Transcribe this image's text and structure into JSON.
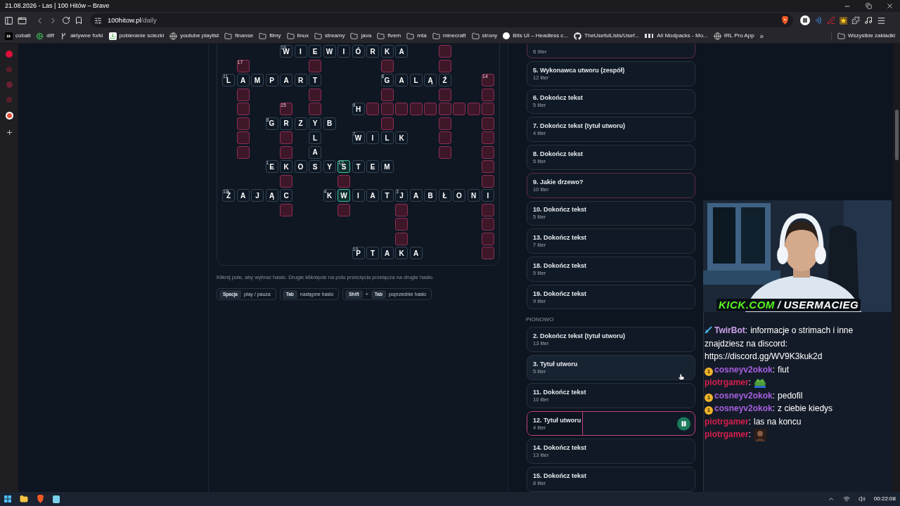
{
  "window": {
    "title": "21.08.2026 - Las | 100 Hitów – Brave"
  },
  "address_bar": {
    "host": "100hitow.pl",
    "path": "/daily"
  },
  "bookmarks": [
    {
      "kind": "link",
      "label": "cobalt"
    },
    {
      "kind": "link",
      "label": "diff"
    },
    {
      "kind": "link",
      "label": "aktywne forki"
    },
    {
      "kind": "link",
      "label": "pobieranie sciezki"
    },
    {
      "kind": "link",
      "label": "youtube playlist"
    },
    {
      "kind": "folder",
      "label": "finanse"
    },
    {
      "kind": "folder",
      "label": "filmy"
    },
    {
      "kind": "folder",
      "label": "linux"
    },
    {
      "kind": "folder",
      "label": "streamy"
    },
    {
      "kind": "folder",
      "label": "java"
    },
    {
      "kind": "folder",
      "label": "fivem"
    },
    {
      "kind": "folder",
      "label": "mta"
    },
    {
      "kind": "folder",
      "label": "minecraft"
    },
    {
      "kind": "folder",
      "label": "strony"
    },
    {
      "kind": "link",
      "label": "Bits UI – Headless c..."
    },
    {
      "kind": "link",
      "label": "TheUsefulLists/Usef..."
    },
    {
      "kind": "link",
      "label": "All Modpacks - Mo..."
    },
    {
      "kind": "link",
      "label": "IRL Pro App"
    }
  ],
  "bookmarks_overflow": "»",
  "all_bookmarks": "Wszystkie zakładki",
  "crossword": {
    "rows": [
      {
        "cells": [
          {
            "kind": "blank"
          },
          {
            "kind": "blank"
          },
          {
            "kind": "blank"
          },
          {
            "kind": "blank"
          },
          {
            "kind": "letter",
            "letter": "W",
            "number": "19",
            "selected": false
          },
          {
            "kind": "letter",
            "letter": "I",
            "selected": false
          },
          {
            "kind": "letter",
            "letter": "E",
            "selected": false
          },
          {
            "kind": "letter",
            "letter": "W",
            "selected": false
          },
          {
            "kind": "letter",
            "letter": "I",
            "selected": false
          },
          {
            "kind": "letter",
            "letter": "Ó",
            "selected": false
          },
          {
            "kind": "letter",
            "letter": "R",
            "selected": false
          },
          {
            "kind": "letter",
            "letter": "K",
            "selected": false
          },
          {
            "kind": "letter",
            "letter": "A",
            "selected": false
          },
          {
            "kind": "blank"
          },
          {
            "kind": "blank"
          },
          {
            "kind": "empty",
            "selected": false
          },
          {
            "kind": "blank"
          },
          {
            "kind": "blank"
          },
          {
            "kind": "blank"
          }
        ]
      },
      {
        "cells": [
          {
            "kind": "blank"
          },
          {
            "kind": "empty",
            "number": "17",
            "selected": false
          },
          {
            "kind": "blank"
          },
          {
            "kind": "blank"
          },
          {
            "kind": "blank"
          },
          {
            "kind": "blank"
          },
          {
            "kind": "empty",
            "selected": false
          },
          {
            "kind": "blank"
          },
          {
            "kind": "blank"
          },
          {
            "kind": "blank"
          },
          {
            "kind": "blank"
          },
          {
            "kind": "empty",
            "selected": false
          },
          {
            "kind": "blank"
          },
          {
            "kind": "blank"
          },
          {
            "kind": "blank"
          },
          {
            "kind": "empty",
            "selected": false
          },
          {
            "kind": "blank"
          },
          {
            "kind": "blank"
          },
          {
            "kind": "blank"
          }
        ]
      },
      {
        "cells": [
          {
            "kind": "letter",
            "letter": "L",
            "number": "11",
            "selected": false
          },
          {
            "kind": "letter",
            "letter": "A",
            "selected": false
          },
          {
            "kind": "letter",
            "letter": "M",
            "selected": false
          },
          {
            "kind": "letter",
            "letter": "P",
            "selected": false
          },
          {
            "kind": "letter",
            "letter": "A",
            "selected": false
          },
          {
            "kind": "letter",
            "letter": "R",
            "selected": false
          },
          {
            "kind": "letter",
            "letter": "T",
            "selected": false
          },
          {
            "kind": "blank"
          },
          {
            "kind": "blank"
          },
          {
            "kind": "blank"
          },
          {
            "kind": "blank"
          },
          {
            "kind": "letter",
            "letter": "G",
            "number": "6",
            "selected": false
          },
          {
            "kind": "letter",
            "letter": "A",
            "selected": false
          },
          {
            "kind": "letter",
            "letter": "L",
            "selected": false
          },
          {
            "kind": "letter",
            "letter": "Ą",
            "selected": false
          },
          {
            "kind": "letter",
            "letter": "Ź",
            "selected": false
          },
          {
            "kind": "blank"
          },
          {
            "kind": "blank"
          },
          {
            "kind": "empty",
            "number": "14",
            "selected": false
          }
        ]
      },
      {
        "cells": [
          {
            "kind": "blank"
          },
          {
            "kind": "empty",
            "selected": false
          },
          {
            "kind": "blank"
          },
          {
            "kind": "blank"
          },
          {
            "kind": "blank"
          },
          {
            "kind": "blank"
          },
          {
            "kind": "empty",
            "selected": false
          },
          {
            "kind": "blank"
          },
          {
            "kind": "blank"
          },
          {
            "kind": "blank"
          },
          {
            "kind": "blank"
          },
          {
            "kind": "empty",
            "selected": false
          },
          {
            "kind": "blank"
          },
          {
            "kind": "blank"
          },
          {
            "kind": "blank"
          },
          {
            "kind": "empty",
            "selected": false
          },
          {
            "kind": "blank"
          },
          {
            "kind": "blank"
          },
          {
            "kind": "empty",
            "selected": false
          }
        ]
      },
      {
        "cells": [
          {
            "kind": "blank"
          },
          {
            "kind": "empty",
            "selected": false
          },
          {
            "kind": "blank"
          },
          {
            "kind": "blank"
          },
          {
            "kind": "empty",
            "number": "15",
            "selected": false
          },
          {
            "kind": "blank"
          },
          {
            "kind": "empty",
            "selected": false
          },
          {
            "kind": "blank"
          },
          {
            "kind": "blank"
          },
          {
            "kind": "letter",
            "letter": "H",
            "number": "9",
            "selected": false
          },
          {
            "kind": "empty",
            "selected": false
          },
          {
            "kind": "empty",
            "selected": false
          },
          {
            "kind": "empty",
            "selected": false
          },
          {
            "kind": "empty",
            "selected": false
          },
          {
            "kind": "empty",
            "selected": false
          },
          {
            "kind": "empty",
            "selected": false
          },
          {
            "kind": "empty",
            "selected": false
          },
          {
            "kind": "empty",
            "selected": false
          },
          {
            "kind": "empty",
            "selected": false
          }
        ]
      },
      {
        "cells": [
          {
            "kind": "blank"
          },
          {
            "kind": "empty",
            "selected": false
          },
          {
            "kind": "blank"
          },
          {
            "kind": "letter",
            "letter": "G",
            "number": "8",
            "selected": false
          },
          {
            "kind": "letter",
            "letter": "R",
            "selected": false
          },
          {
            "kind": "letter",
            "letter": "Z",
            "selected": false
          },
          {
            "kind": "letter",
            "letter": "Y",
            "selected": false
          },
          {
            "kind": "letter",
            "letter": "B",
            "selected": false
          },
          {
            "kind": "blank"
          },
          {
            "kind": "blank"
          },
          {
            "kind": "blank"
          },
          {
            "kind": "empty",
            "selected": false
          },
          {
            "kind": "blank"
          },
          {
            "kind": "blank"
          },
          {
            "kind": "blank"
          },
          {
            "kind": "empty",
            "selected": false
          },
          {
            "kind": "blank"
          },
          {
            "kind": "blank"
          },
          {
            "kind": "empty",
            "selected": false
          }
        ]
      },
      {
        "cells": [
          {
            "kind": "blank"
          },
          {
            "kind": "empty",
            "selected": false
          },
          {
            "kind": "blank"
          },
          {
            "kind": "blank"
          },
          {
            "kind": "empty",
            "selected": false
          },
          {
            "kind": "blank"
          },
          {
            "kind": "letter",
            "letter": "L",
            "selected": false
          },
          {
            "kind": "blank"
          },
          {
            "kind": "blank"
          },
          {
            "kind": "letter",
            "letter": "W",
            "number": "7",
            "selected": false
          },
          {
            "kind": "letter",
            "letter": "I",
            "selected": false
          },
          {
            "kind": "letter",
            "letter": "L",
            "selected": false
          },
          {
            "kind": "letter",
            "letter": "K",
            "selected": false
          },
          {
            "kind": "blank"
          },
          {
            "kind": "blank"
          },
          {
            "kind": "empty",
            "selected": false
          },
          {
            "kind": "blank"
          },
          {
            "kind": "blank"
          },
          {
            "kind": "empty",
            "selected": false
          }
        ]
      },
      {
        "cells": [
          {
            "kind": "blank"
          },
          {
            "kind": "empty",
            "selected": false
          },
          {
            "kind": "blank"
          },
          {
            "kind": "blank"
          },
          {
            "kind": "empty",
            "selected": false
          },
          {
            "kind": "blank"
          },
          {
            "kind": "letter",
            "letter": "A",
            "selected": false
          },
          {
            "kind": "blank"
          },
          {
            "kind": "blank"
          },
          {
            "kind": "blank"
          },
          {
            "kind": "blank"
          },
          {
            "kind": "blank"
          },
          {
            "kind": "blank"
          },
          {
            "kind": "blank"
          },
          {
            "kind": "blank"
          },
          {
            "kind": "empty",
            "selected": false
          },
          {
            "kind": "blank"
          },
          {
            "kind": "blank"
          },
          {
            "kind": "empty",
            "selected": false
          }
        ]
      },
      {
        "cells": [
          {
            "kind": "blank"
          },
          {
            "kind": "blank"
          },
          {
            "kind": "blank"
          },
          {
            "kind": "letter",
            "letter": "E",
            "number": "1",
            "selected": false
          },
          {
            "kind": "letter",
            "letter": "K",
            "selected": false
          },
          {
            "kind": "letter",
            "letter": "O",
            "selected": false
          },
          {
            "kind": "letter",
            "letter": "S",
            "selected": false
          },
          {
            "kind": "letter",
            "letter": "Y",
            "selected": false
          },
          {
            "kind": "letter",
            "letter": "S",
            "number": "12",
            "selected": true
          },
          {
            "kind": "letter",
            "letter": "T",
            "selected": false
          },
          {
            "kind": "letter",
            "letter": "E",
            "selected": false
          },
          {
            "kind": "letter",
            "letter": "M",
            "selected": false
          },
          {
            "kind": "blank"
          },
          {
            "kind": "blank"
          },
          {
            "kind": "blank"
          },
          {
            "kind": "blank"
          },
          {
            "kind": "blank"
          },
          {
            "kind": "blank"
          },
          {
            "kind": "empty",
            "selected": false
          }
        ]
      },
      {
        "cells": [
          {
            "kind": "blank"
          },
          {
            "kind": "blank"
          },
          {
            "kind": "blank"
          },
          {
            "kind": "blank"
          },
          {
            "kind": "empty",
            "selected": false
          },
          {
            "kind": "blank"
          },
          {
            "kind": "blank"
          },
          {
            "kind": "blank"
          },
          {
            "kind": "empty",
            "selected": false
          },
          {
            "kind": "blank"
          },
          {
            "kind": "blank"
          },
          {
            "kind": "blank"
          },
          {
            "kind": "blank"
          },
          {
            "kind": "blank"
          },
          {
            "kind": "blank"
          },
          {
            "kind": "blank"
          },
          {
            "kind": "blank"
          },
          {
            "kind": "blank"
          },
          {
            "kind": "empty",
            "selected": false
          }
        ]
      },
      {
        "cells": [
          {
            "kind": "letter",
            "letter": "Ż",
            "number": "18",
            "selected": false
          },
          {
            "kind": "letter",
            "letter": "A",
            "selected": false
          },
          {
            "kind": "letter",
            "letter": "J",
            "selected": false
          },
          {
            "kind": "letter",
            "letter": "Ą",
            "selected": false
          },
          {
            "kind": "letter",
            "letter": "C",
            "selected": false
          },
          {
            "kind": "blank"
          },
          {
            "kind": "blank"
          },
          {
            "kind": "letter",
            "letter": "K",
            "number": "4",
            "selected": false
          },
          {
            "kind": "letter",
            "letter": "W",
            "selected": true
          },
          {
            "kind": "letter",
            "letter": "I",
            "selected": false
          },
          {
            "kind": "letter",
            "letter": "A",
            "selected": false
          },
          {
            "kind": "letter",
            "letter": "T",
            "selected": false
          },
          {
            "kind": "letter",
            "letter": "J",
            "number": "3",
            "selected": false
          },
          {
            "kind": "letter",
            "letter": "A",
            "selected": false
          },
          {
            "kind": "letter",
            "letter": "B",
            "selected": false
          },
          {
            "kind": "letter",
            "letter": "Ł",
            "selected": false
          },
          {
            "kind": "letter",
            "letter": "O",
            "selected": false
          },
          {
            "kind": "letter",
            "letter": "N",
            "selected": false
          },
          {
            "kind": "letter",
            "letter": "I",
            "selected": false
          }
        ]
      },
      {
        "cells": [
          {
            "kind": "blank"
          },
          {
            "kind": "blank"
          },
          {
            "kind": "blank"
          },
          {
            "kind": "blank"
          },
          {
            "kind": "empty",
            "selected": false
          },
          {
            "kind": "blank"
          },
          {
            "kind": "blank"
          },
          {
            "kind": "blank"
          },
          {
            "kind": "empty",
            "selected": false
          },
          {
            "kind": "blank"
          },
          {
            "kind": "blank"
          },
          {
            "kind": "blank"
          },
          {
            "kind": "empty",
            "selected": false
          },
          {
            "kind": "blank"
          },
          {
            "kind": "blank"
          },
          {
            "kind": "blank"
          },
          {
            "kind": "blank"
          },
          {
            "kind": "blank"
          },
          {
            "kind": "empty",
            "selected": false
          }
        ]
      },
      {
        "cells": [
          {
            "kind": "blank"
          },
          {
            "kind": "blank"
          },
          {
            "kind": "blank"
          },
          {
            "kind": "blank"
          },
          {
            "kind": "blank"
          },
          {
            "kind": "blank"
          },
          {
            "kind": "blank"
          },
          {
            "kind": "blank"
          },
          {
            "kind": "blank"
          },
          {
            "kind": "blank"
          },
          {
            "kind": "blank"
          },
          {
            "kind": "blank"
          },
          {
            "kind": "empty",
            "selected": false
          },
          {
            "kind": "blank"
          },
          {
            "kind": "blank"
          },
          {
            "kind": "blank"
          },
          {
            "kind": "blank"
          },
          {
            "kind": "blank"
          },
          {
            "kind": "empty",
            "selected": false
          }
        ]
      },
      {
        "cells": [
          {
            "kind": "blank"
          },
          {
            "kind": "blank"
          },
          {
            "kind": "blank"
          },
          {
            "kind": "blank"
          },
          {
            "kind": "blank"
          },
          {
            "kind": "blank"
          },
          {
            "kind": "blank"
          },
          {
            "kind": "blank"
          },
          {
            "kind": "blank"
          },
          {
            "kind": "blank"
          },
          {
            "kind": "blank"
          },
          {
            "kind": "blank"
          },
          {
            "kind": "empty",
            "selected": false
          },
          {
            "kind": "blank"
          },
          {
            "kind": "blank"
          },
          {
            "kind": "blank"
          },
          {
            "kind": "blank"
          },
          {
            "kind": "blank"
          },
          {
            "kind": "empty",
            "selected": false
          }
        ]
      },
      {
        "cells": [
          {
            "kind": "blank"
          },
          {
            "kind": "blank"
          },
          {
            "kind": "blank"
          },
          {
            "kind": "blank"
          },
          {
            "kind": "blank"
          },
          {
            "kind": "blank"
          },
          {
            "kind": "blank"
          },
          {
            "kind": "blank"
          },
          {
            "kind": "blank"
          },
          {
            "kind": "letter",
            "letter": "P",
            "number": "10",
            "selected": false
          },
          {
            "kind": "letter",
            "letter": "T",
            "selected": false
          },
          {
            "kind": "letter",
            "letter": "A",
            "selected": false
          },
          {
            "kind": "letter",
            "letter": "K",
            "selected": false
          },
          {
            "kind": "letter",
            "letter": "A",
            "selected": false
          },
          {
            "kind": "blank"
          },
          {
            "kind": "blank"
          },
          {
            "kind": "blank"
          },
          {
            "kind": "blank"
          },
          {
            "kind": "empty",
            "selected": false
          }
        ]
      }
    ]
  },
  "hint": "Kliknij pole, aby wybrać hasło. Drugie kliknięcie na polu przecięcia przełącza na drugie hasło.",
  "shortcuts": [
    {
      "keys": [
        "Spacja"
      ],
      "action": "play / pauza"
    },
    {
      "keys": [
        "Tab"
      ],
      "action": "następne hasło"
    },
    {
      "keys": [
        "Shift",
        "Tab"
      ],
      "joiner": "+",
      "action": "poprzednie hasło"
    }
  ],
  "clues": {
    "across": [
      {
        "letters": "6 liter",
        "highlighted": true,
        "selected": false,
        "hovered": false
      },
      {
        "title": "5. Wykonawca utworu (zespół)",
        "letters": "12 liter",
        "highlighted": false,
        "selected": false,
        "hovered": false
      },
      {
        "title": "6. Dokończ tekst",
        "letters": "5 liter",
        "highlighted": false,
        "selected": false,
        "hovered": false
      },
      {
        "title": "7. Dokończ tekst (tytuł utworu)",
        "letters": "4 liter",
        "highlighted": false,
        "selected": false,
        "hovered": false
      },
      {
        "title": "8. Dokończ tekst",
        "letters": "5 liter",
        "highlighted": false,
        "selected": false,
        "hovered": false
      },
      {
        "title": "9. Jakie drzewo?",
        "letters": "10 liter",
        "highlighted": true,
        "selected": false,
        "hovered": false
      },
      {
        "title": "10. Dokończ tekst",
        "letters": "5 liter",
        "highlighted": false,
        "selected": false,
        "hovered": false
      },
      {
        "title": "13. Dokończ tekst",
        "letters": "7 liter",
        "highlighted": false,
        "selected": false,
        "hovered": false
      },
      {
        "title": "18. Dokończ tekst",
        "letters": "5 liter",
        "highlighted": false,
        "selected": false,
        "hovered": false
      },
      {
        "title": "19. Dokończ tekst",
        "letters": "9 liter",
        "highlighted": false,
        "selected": false,
        "hovered": false
      }
    ],
    "down_heading": "PIONOWO",
    "down": [
      {
        "title": "2. Dokończ tekst (tytuł utworu)",
        "letters": "13 liter",
        "highlighted": false,
        "selected": false,
        "hovered": false
      },
      {
        "title": "3. Tytuł utworu",
        "letters": "5 liter",
        "highlighted": false,
        "selected": false,
        "hovered": true
      },
      {
        "title": "11. Dokończ tekst",
        "letters": "10 liter",
        "highlighted": false,
        "selected": false,
        "hovered": false
      },
      {
        "title": "12. Tytuł utworu",
        "letters": "4 liter",
        "selected": true,
        "hovered": false,
        "level": 0.33
      },
      {
        "title": "14. Dokończ tekst",
        "letters": "13 liter",
        "highlighted": false,
        "selected": false,
        "hovered": false
      },
      {
        "title": "15. Dokończ tekst",
        "letters": "8 liter",
        "highlighted": false,
        "selected": false,
        "hovered": false
      }
    ]
  },
  "stream_overlay": {
    "caption_site": "KICK.COM",
    "caption_separator": "/",
    "caption_user": "USERMACIEG",
    "chat": [
      {
        "badge": {
          "kind": "bot"
        },
        "user": "TwirBot",
        "separator": ":",
        "color": "#c9a0e8",
        "kind": "text",
        "text": "informacje o strimach i inne znajdziesz na discord: https://discord.gg/WV9K3kuk2d"
      },
      {
        "badge": {
          "kind": "tier",
          "label": "1"
        },
        "user": "cosneyv2okok",
        "separator": ":",
        "color": "#a65fe0",
        "kind": "text",
        "text": "fiut"
      },
      {
        "user": "piotrgamer",
        "separator": ":",
        "color": "#d4204c",
        "kind": "emote"
      },
      {
        "badge": {
          "kind": "tier",
          "label": "1"
        },
        "user": "cosneyv2okok",
        "separator": ":",
        "color": "#a65fe0",
        "kind": "text",
        "text": "pedofil"
      },
      {
        "badge": {
          "kind": "tier",
          "label": "1"
        },
        "user": "cosneyv2okok",
        "separator": ":",
        "color": "#a65fe0",
        "kind": "text",
        "text": "z ciebie kiedys"
      },
      {
        "user": "piotrgamer",
        "separator": ":",
        "color": "#d4204c",
        "kind": "text",
        "text": "las na koncu"
      },
      {
        "user": "piotrgamer",
        "separator": ":",
        "color": "#d4204c",
        "kind": "emote"
      }
    ]
  },
  "taskbar": {
    "clock": "00:22:08"
  }
}
